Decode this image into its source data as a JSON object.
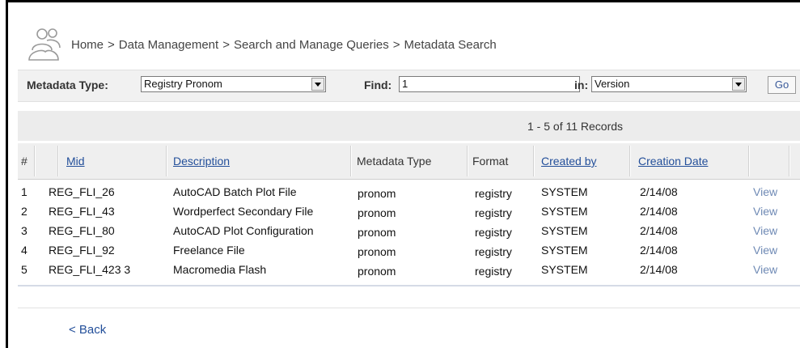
{
  "breadcrumb": {
    "items": [
      "Home",
      "Data Management",
      "Search and Manage Queries",
      "Metadata Search"
    ],
    "separator": ">"
  },
  "search": {
    "metadata_type_label": "Metadata Type:",
    "metadata_type_value": "Registry Pronom",
    "find_label": "Find:",
    "find_value": "1",
    "in_label": "in:",
    "in_value": "Version",
    "go_label": "Go"
  },
  "records": {
    "summary": "1 - 5 of 11 Records"
  },
  "table": {
    "columns": {
      "num": "#",
      "mid": "Mid",
      "description": "Description",
      "metadata_type": "Metadata Type",
      "format": "Format",
      "created_by": "Created by",
      "creation_date": "Creation Date"
    },
    "rows": [
      {
        "num": "1",
        "mid": "REG_FLI_26",
        "description": "AutoCAD Batch Plot File",
        "type": "pronom",
        "format": "registry",
        "created_by": "SYSTEM",
        "date": "2/14/08",
        "action": "View"
      },
      {
        "num": "2",
        "mid": "REG_FLI_43",
        "description": "Wordperfect Secondary File",
        "type": "pronom",
        "format": "registry",
        "created_by": "SYSTEM",
        "date": "2/14/08",
        "action": "View"
      },
      {
        "num": "3",
        "mid": "REG_FLI_80",
        "description": "AutoCAD Plot Configuration",
        "type": "pronom",
        "format": "registry",
        "created_by": "SYSTEM",
        "date": "2/14/08",
        "action": "View"
      },
      {
        "num": "4",
        "mid": "REG_FLI_92",
        "description": "Freelance File",
        "type": "pronom",
        "format": "registry",
        "created_by": "SYSTEM",
        "date": "2/14/08",
        "action": "View"
      },
      {
        "num": "5",
        "mid": "REG_FLI_423 3",
        "description": "Macromedia Flash",
        "type": "pronom",
        "format": "registry",
        "created_by": "SYSTEM",
        "date": "2/14/08",
        "action": "View"
      }
    ]
  },
  "back_label": "< Back",
  "icons": {
    "header": "users-icon",
    "dropdown": "dropdown-arrow-icon"
  },
  "colors": {
    "link": "#234f9a",
    "view_link": "#6f8ab5",
    "header_bg": "#efefef"
  }
}
